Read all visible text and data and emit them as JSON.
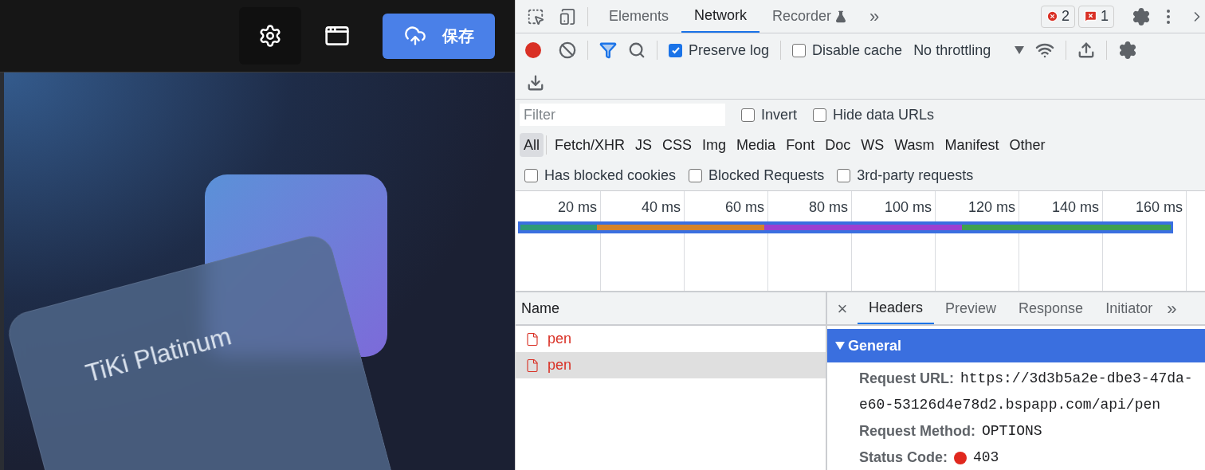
{
  "editor": {
    "save_button": "保存",
    "card_title": "TiKi Platinum"
  },
  "devtools": {
    "tabs": [
      {
        "label": "Elements",
        "selected": false
      },
      {
        "label": "Network",
        "selected": true
      },
      {
        "label": "Recorder",
        "selected": false
      }
    ],
    "more_tabs": "»",
    "error_count": "2",
    "issue_count": "1",
    "toolbar": {
      "preserve_log": {
        "label": "Preserve log",
        "checked": true
      },
      "disable_cache": {
        "label": "Disable cache",
        "checked": false
      },
      "throttling": "No throttling"
    },
    "filter": {
      "placeholder": "Filter",
      "options": [
        {
          "label": "Invert",
          "checked": false
        },
        {
          "label": "Hide data URLs",
          "checked": false
        }
      ]
    },
    "types": [
      {
        "label": "All",
        "selected": true
      },
      {
        "label": "Fetch/XHR",
        "selected": false
      },
      {
        "label": "JS",
        "selected": false
      },
      {
        "label": "CSS",
        "selected": false
      },
      {
        "label": "Img",
        "selected": false
      },
      {
        "label": "Media",
        "selected": false
      },
      {
        "label": "Font",
        "selected": false
      },
      {
        "label": "Doc",
        "selected": false
      },
      {
        "label": "WS",
        "selected": false
      },
      {
        "label": "Wasm",
        "selected": false
      },
      {
        "label": "Manifest",
        "selected": false
      },
      {
        "label": "Other",
        "selected": false
      }
    ],
    "blocked_options": [
      {
        "label": "Has blocked cookies",
        "checked": false
      },
      {
        "label": "Blocked Requests",
        "checked": false
      },
      {
        "label": "3rd-party requests",
        "checked": false
      }
    ],
    "timeline_ticks": [
      "20 ms",
      "40 ms",
      "60 ms",
      "80 ms",
      "100 ms",
      "120 ms",
      "140 ms",
      "160 ms"
    ],
    "requests": {
      "column": "Name",
      "rows": [
        {
          "name": "pen",
          "selected": false,
          "failed": true
        },
        {
          "name": "pen",
          "selected": true,
          "failed": true
        }
      ]
    },
    "detail": {
      "close": "×",
      "tabs": [
        {
          "label": "Headers",
          "selected": true
        },
        {
          "label": "Preview",
          "selected": false
        },
        {
          "label": "Response",
          "selected": false
        },
        {
          "label": "Initiator",
          "selected": false
        }
      ],
      "more_tabs": "»",
      "section": {
        "title": "General",
        "expanded": true,
        "fields": [
          {
            "label": "Request URL:",
            "value_lines": [
              "https://3d3b5a2e-dbe3-47da-",
              "e60-53126d4e78d2.bspapp.com/api/pen"
            ]
          },
          {
            "label": "Request Method:",
            "value_lines": [
              "OPTIONS"
            ]
          },
          {
            "label": "Status Code:",
            "value_lines": [
              "403"
            ],
            "color": "#e0281e"
          }
        ]
      }
    }
  }
}
